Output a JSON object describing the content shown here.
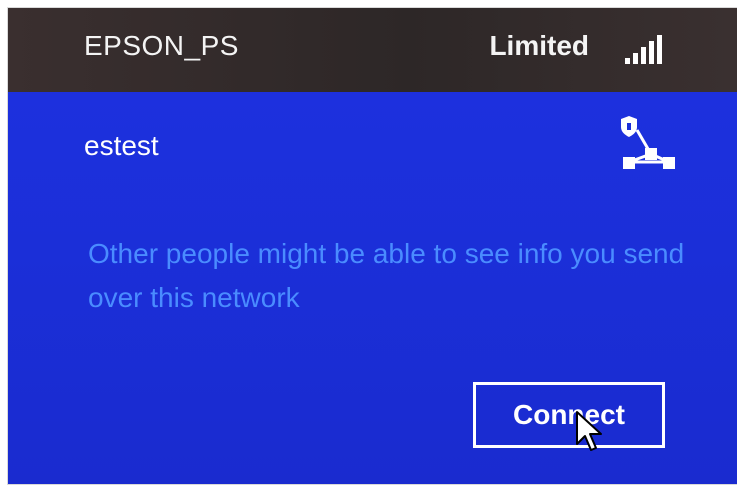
{
  "networks": [
    {
      "ssid": "EPSON_PS",
      "status": "Limited",
      "icon": "wifi-signal-icon"
    }
  ],
  "selected_network": {
    "ssid": "estest",
    "icon": "shield-network-icon",
    "warning": "Other people might be able to see info you send over this network",
    "connect_label": "Connect"
  },
  "colors": {
    "panel_blue": "#1a2bd4",
    "warning_text": "#4a8cff",
    "top_bar": "#2d2727"
  }
}
